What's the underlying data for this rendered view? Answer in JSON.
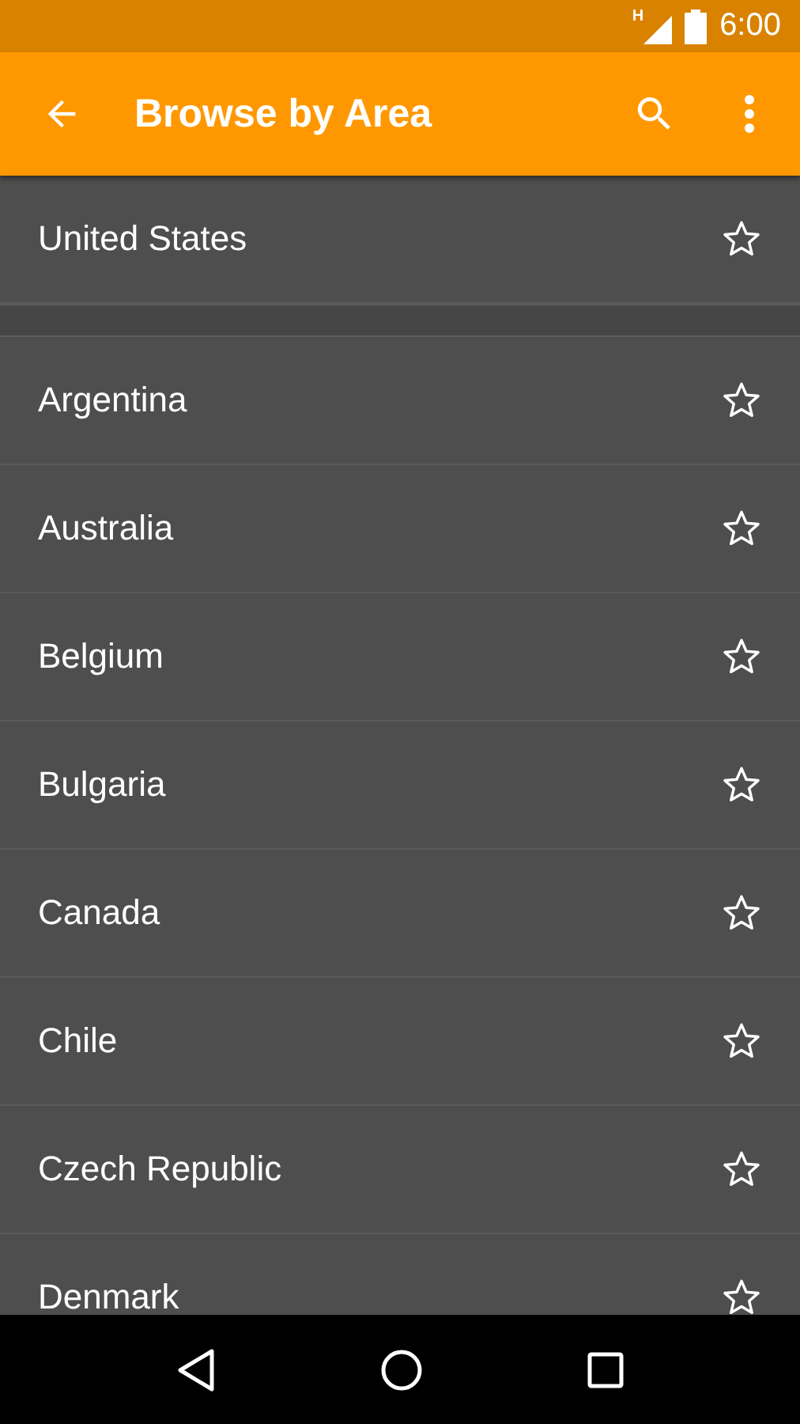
{
  "status_bar": {
    "network_label": "H",
    "time": "6:00"
  },
  "toolbar": {
    "title": "Browse by Area"
  },
  "sections": [
    {
      "items": [
        {
          "name": "United States",
          "starred": false
        }
      ]
    },
    {
      "items": [
        {
          "name": "Argentina",
          "starred": false
        },
        {
          "name": "Australia",
          "starred": false
        },
        {
          "name": "Belgium",
          "starred": false
        },
        {
          "name": "Bulgaria",
          "starred": false
        },
        {
          "name": "Canada",
          "starred": false
        },
        {
          "name": "Chile",
          "starred": false
        },
        {
          "name": "Czech Republic",
          "starred": false
        },
        {
          "name": "Denmark",
          "starred": false
        }
      ]
    }
  ]
}
